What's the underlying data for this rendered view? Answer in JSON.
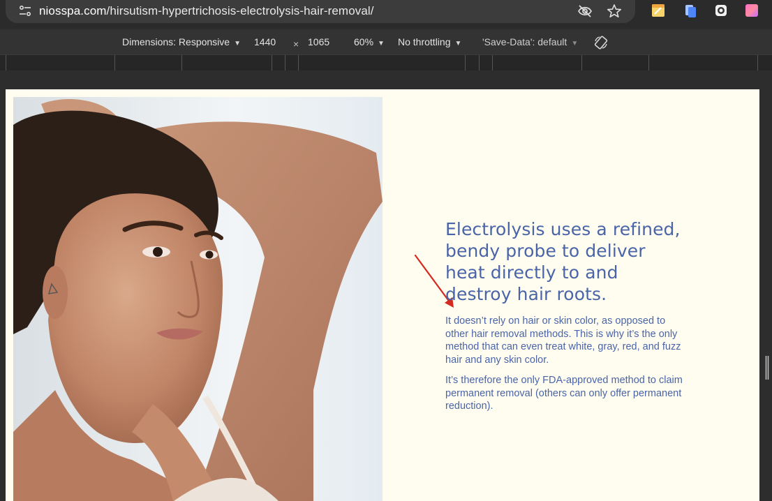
{
  "browser": {
    "url_host": "niosspa.com",
    "url_path": "/hirsutism-hypertrichosis-electrolysis-hair-removal/",
    "icons": [
      "site-info-icon",
      "eye-off-icon",
      "bookmark-star-icon",
      "extension-notes-icon",
      "extension-copy-icon",
      "extension-record-icon",
      "extension-gradient-icon"
    ]
  },
  "devtools": {
    "dimensions_label": "Dimensions: Responsive",
    "width": "1440",
    "times": "×",
    "height": "1065",
    "zoom": "60%",
    "throttling": "No throttling",
    "save_data": "'Save-Data': default"
  },
  "page": {
    "headline": "Electrolysis uses a refined, bendy probe to deliver heat directly to and destroy hair roots.",
    "para1": "It doesn’t rely on hair or skin color, as opposed to other hair removal methods. This is why it’s the only method that can even treat white, gray, red, and fuzz hair and any skin color.",
    "para2": "It’s therefore the only FDA-approved method to claim permanent removal (others can only offer permanent reduction).",
    "colors": {
      "text": "#4a64a8",
      "background": "#fffdf0",
      "annotation_arrow": "#d42a20"
    }
  }
}
